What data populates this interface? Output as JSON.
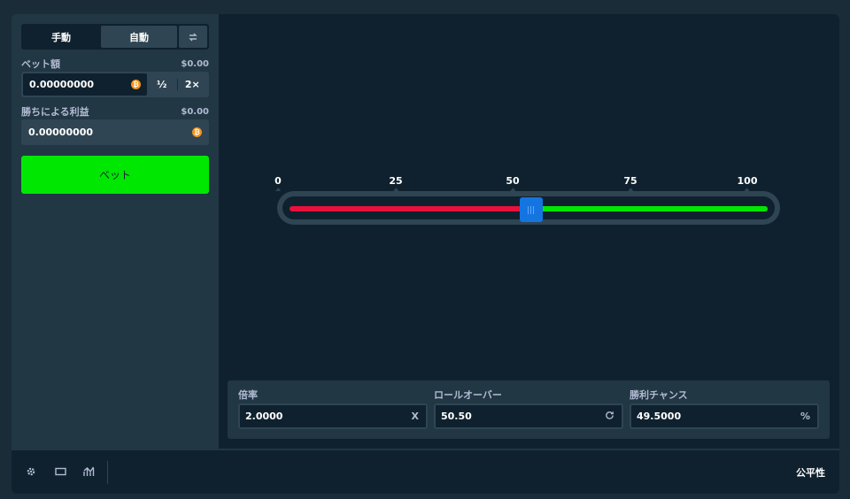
{
  "sidebar": {
    "tabs": {
      "manual": "手動",
      "auto": "自動",
      "swap_icon": "swap-icon"
    },
    "bet_amount": {
      "label": "ベット額",
      "usd": "$0.00",
      "value": "0.00000000",
      "coin": "bitcoin-icon",
      "half_label": "½",
      "double_label": "2×"
    },
    "profit": {
      "label": "勝ちによる利益",
      "usd": "$0.00",
      "value": "0.00000000",
      "coin": "bitcoin-icon"
    },
    "bet_button": "ベット"
  },
  "game": {
    "slider": {
      "ticks": [
        "0",
        "25",
        "50",
        "75",
        "100"
      ],
      "min": 0,
      "max": 100,
      "value": 50.5,
      "lose_color": "#e9113c",
      "win_color": "#00e701",
      "thumb_color": "#1475e1"
    },
    "stats": {
      "multiplier": {
        "label": "倍率",
        "value": "2.0000",
        "suffix": "X"
      },
      "roll_over": {
        "label": "ロールオーバー",
        "value": "50.50",
        "suffix": "refresh-icon"
      },
      "win_chance": {
        "label": "勝利チャンス",
        "value": "49.5000",
        "suffix": "%"
      }
    }
  },
  "footer": {
    "icons": [
      "gear-icon",
      "screen-icon",
      "stats-icon"
    ],
    "fairness": "公平性"
  },
  "colors": {
    "background": "#1a2c38",
    "panel": "#213743",
    "dark": "#0f212e",
    "accent_green": "#00e701"
  }
}
